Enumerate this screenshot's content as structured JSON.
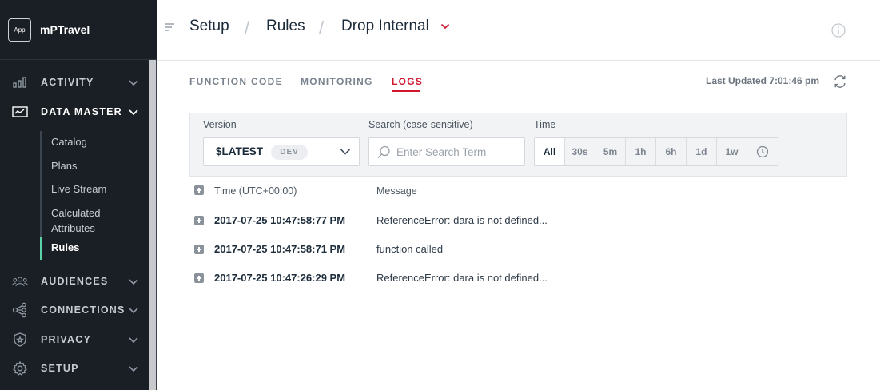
{
  "app": {
    "logo_text": "App",
    "name": "mPTravel"
  },
  "sidebar": {
    "items": [
      {
        "label": "ACTIVITY",
        "icon": "bar-chart-icon"
      },
      {
        "label": "DATA MASTER",
        "icon": "database-icon"
      },
      {
        "label": "AUDIENCES",
        "icon": "people-icon"
      },
      {
        "label": "CONNECTIONS",
        "icon": "connections-icon"
      },
      {
        "label": "PRIVACY",
        "icon": "shield-icon"
      },
      {
        "label": "SETUP",
        "icon": "gear-icon"
      }
    ],
    "sub_items": [
      {
        "label": "Catalog"
      },
      {
        "label": "Plans"
      },
      {
        "label": "Live Stream"
      },
      {
        "label": "Calculated Attributes"
      },
      {
        "label": "Rules"
      }
    ]
  },
  "header": {
    "breadcrumbs": [
      "Setup",
      "Rules",
      "Drop Internal"
    ]
  },
  "tabs": {
    "items": [
      "FUNCTION CODE",
      "MONITORING",
      "LOGS"
    ],
    "active": "LOGS",
    "last_updated": "Last Updated 7:01:46 pm"
  },
  "filters": {
    "version_label": "Version",
    "version_value": "$LATEST",
    "version_badge": "DEV",
    "search_label": "Search (case-sensitive)",
    "search_placeholder": "Enter Search Term",
    "time_label": "Time",
    "time_options": [
      "All",
      "30s",
      "5m",
      "1h",
      "6h",
      "1d",
      "1w"
    ],
    "time_selected": "All"
  },
  "table": {
    "columns": [
      "Time (UTC+00:00)",
      "Message"
    ],
    "rows": [
      {
        "time": "2017-07-25 10:47:58:77 PM",
        "message": "ReferenceError: dara is not defined..."
      },
      {
        "time": "2017-07-25 10:47:58:71 PM",
        "message": "function called"
      },
      {
        "time": "2017-07-25 10:47:26:29 PM",
        "message": "ReferenceError: dara is not defined..."
      }
    ]
  },
  "colors": {
    "accent": "#d0182f",
    "sidebar_bg": "#1a1f26",
    "active_marker": "#5ad3a8"
  }
}
